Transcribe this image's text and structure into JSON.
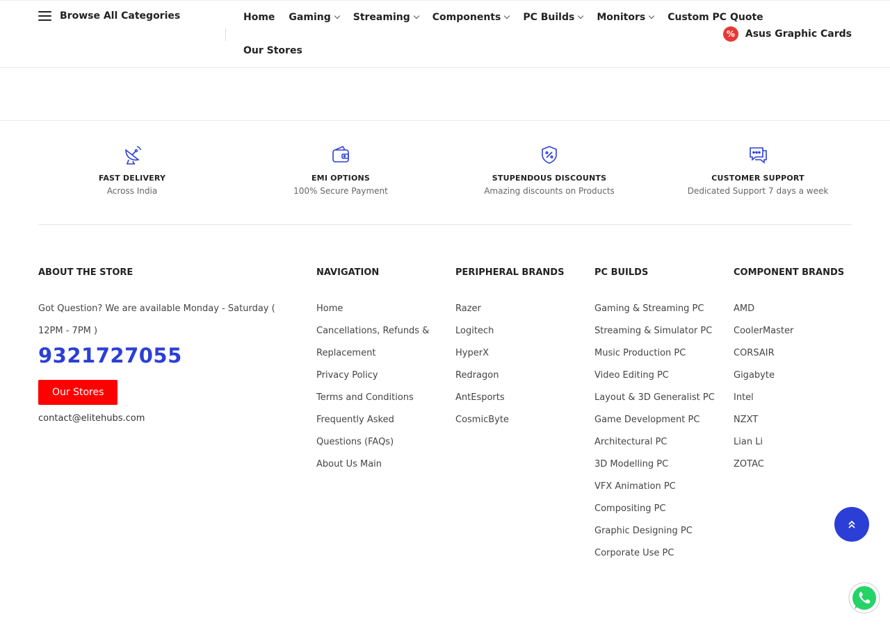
{
  "header": {
    "browse_label": "Browse All Categories",
    "nav_row1": [
      {
        "label": "Home",
        "dropdown": false
      },
      {
        "label": "Gaming",
        "dropdown": true
      },
      {
        "label": "Streaming",
        "dropdown": true
      },
      {
        "label": "Components",
        "dropdown": true
      },
      {
        "label": "PC Builds",
        "dropdown": true
      },
      {
        "label": "Monitors",
        "dropdown": true
      },
      {
        "label": "Custom PC Quote",
        "dropdown": false
      }
    ],
    "nav_row2": [
      {
        "label": "Our Stores",
        "dropdown": false
      }
    ],
    "promo_label": "Asus Graphic Cards",
    "promo_badge": "%"
  },
  "features": [
    {
      "icon": "satellite-dish-icon",
      "title": "FAST DELIVERY",
      "subtitle": "Across India"
    },
    {
      "icon": "wallet-icon",
      "title": "EMI OPTIONS",
      "subtitle": "100% Secure Payment"
    },
    {
      "icon": "discount-shield-icon",
      "title": "STUPENDOUS DISCOUNTS",
      "subtitle": "Amazing discounts on Products"
    },
    {
      "icon": "chat-bubble-icon",
      "title": "CUSTOMER SUPPORT",
      "subtitle": "Dedicated Support 7 days a week"
    }
  ],
  "footer": {
    "about": {
      "heading": "ABOUT THE STORE",
      "text": "Got Question? We are available Monday - Saturday ( 12PM - 7PM )",
      "phone": "9321727055",
      "button": "Our Stores",
      "email": "contact@elitehubs.com"
    },
    "navigation": {
      "heading": "NAVIGATION",
      "items": [
        "Home",
        "Cancellations, Refunds & Replacement",
        "Privacy Policy",
        "Terms and Conditions",
        "Frequently Asked Questions (FAQs)",
        "About Us Main"
      ]
    },
    "peripheral_brands": {
      "heading": "PERIPHERAL BRANDS",
      "items": [
        "Razer",
        "Logitech",
        "HyperX",
        "Redragon",
        "AntEsports",
        "CosmicByte"
      ]
    },
    "pc_builds": {
      "heading": "PC BUILDS",
      "items": [
        "Gaming & Streaming PC",
        "Streaming & Simulator PC",
        "Music Production PC",
        "Video Editing PC",
        "Layout & 3D Generalist PC",
        "Game Development PC",
        "Architectural PC",
        "3D Modelling PC",
        "VFX Animation PC",
        "Compositing PC",
        "Graphic Designing PC",
        "Corporate Use PC"
      ]
    },
    "component_brands": {
      "heading": "COMPONENT BRANDS",
      "items": [
        "AMD",
        "CoolerMaster",
        "CORSAIR",
        "Gigabyte",
        "Intel",
        "NZXT",
        "Lian Li",
        "ZOTAC"
      ]
    }
  },
  "colors": {
    "accent": "#2b3fd6",
    "button": "#ff0000",
    "whatsapp": "#25d366",
    "promo_badge": "#e53935"
  }
}
